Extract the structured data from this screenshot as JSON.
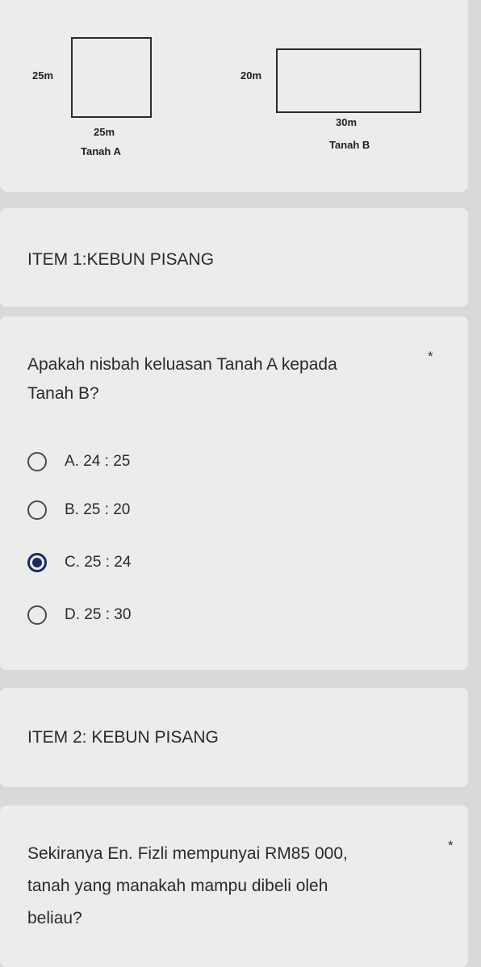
{
  "figure": {
    "tanah_a": {
      "side_label": "25m",
      "bottom_label": "25m",
      "caption": "Tanah A"
    },
    "tanah_b": {
      "side_label": "20m",
      "bottom_label": "30m",
      "caption": "Tanah B"
    }
  },
  "item1": {
    "title": "ITEM 1:KEBUN PISANG"
  },
  "question1": {
    "text_line1": "Apakah nisbah keluasan Tanah A kepada",
    "text_line2": "Tanah B?",
    "required_marker": "*",
    "options": [
      {
        "label": "A. 24 : 25",
        "selected": false
      },
      {
        "label": "B. 25 : 20",
        "selected": false
      },
      {
        "label": "C. 25 : 24",
        "selected": true
      },
      {
        "label": "D. 25 : 30",
        "selected": false
      }
    ]
  },
  "item2": {
    "title": "ITEM 2: KEBUN PISANG"
  },
  "question2": {
    "text_line1": "Sekiranya En. Fizli mempunyai RM85 000,",
    "text_line2": "tanah yang manakah mampu dibeli oleh",
    "text_line3": "beliau?",
    "required_marker": "*"
  }
}
